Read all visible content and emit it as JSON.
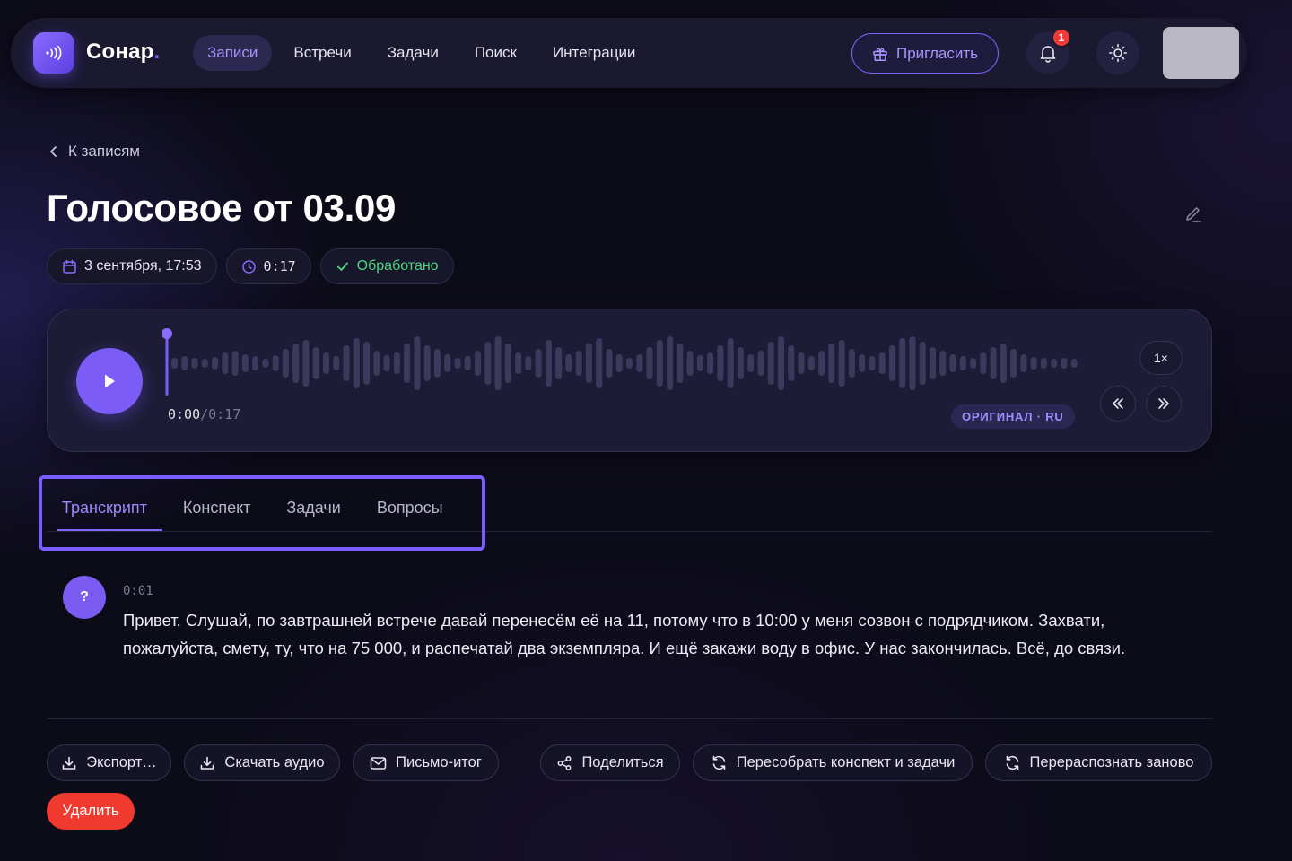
{
  "app": {
    "name": "Сонар",
    "name_dot": "."
  },
  "nav": {
    "items": [
      {
        "label": "Записи",
        "active": true
      },
      {
        "label": "Встречи"
      },
      {
        "label": "Задачи"
      },
      {
        "label": "Поиск"
      },
      {
        "label": "Интеграции"
      }
    ],
    "invite_label": "Пригласить",
    "notifications_count": "1"
  },
  "back_label": "К записям",
  "record": {
    "title": "Голосовое от 03.09",
    "date": "3 сентября, 17:53",
    "duration": "0:17",
    "status": "Обработано"
  },
  "player": {
    "current_time": "0:00",
    "separator": "/",
    "total_time": "0:17",
    "language_badge": "ОРИГИНАЛ · RU",
    "speed": "1×",
    "progress_fraction": 0
  },
  "tabs": [
    {
      "label": "Транскрипт",
      "active": true
    },
    {
      "label": "Конспект"
    },
    {
      "label": "Задачи"
    },
    {
      "label": "Вопросы"
    }
  ],
  "transcript": [
    {
      "speaker_initial": "?",
      "time": "0:01",
      "text": "Привет. Слушай, по завтрашней встрече давай перенесём её на 11, потому что в 10:00 у меня созвон с подрядчиком. Захвати, пожалуйста, смету, ту, что на 75 000, и распечатай два экземпляра. И ещё закажи воду в офис. У нас закончилась. Всё, до связи."
    }
  ],
  "actions": {
    "export": "Экспорт…",
    "download_audio": "Скачать аудио",
    "summary_email": "Письмо-итог",
    "share": "Поделиться",
    "rebuild": "Пересобрать конспект и задачи",
    "rerecognize": "Перераспознать заново",
    "delete": "Удалить"
  },
  "colors": {
    "accent": "#7c5cf6",
    "accent_text": "#a893ff",
    "success": "#4cd47f",
    "danger": "#f0392f",
    "background": "#0c0b18"
  }
}
